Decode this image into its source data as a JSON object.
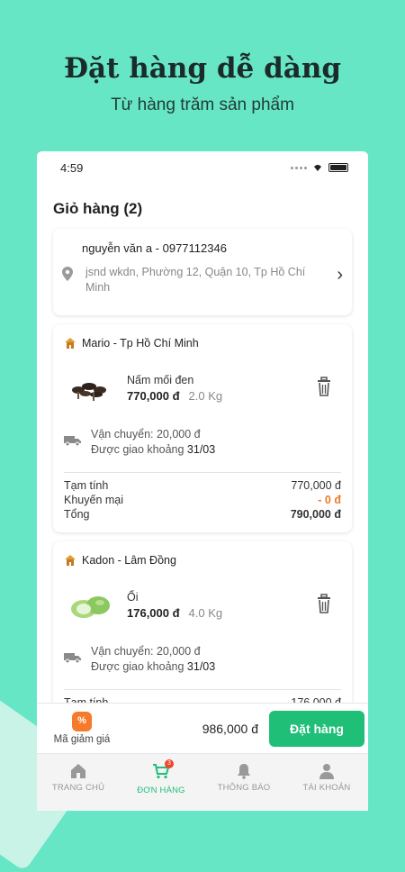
{
  "hero": {
    "title": "Đặt hàng dễ dàng",
    "subtitle": "Từ hàng trăm sản phẩm"
  },
  "status_bar": {
    "time": "4:59"
  },
  "cart": {
    "title": "Giỏ hàng (2)",
    "address": {
      "name_phone": "nguyễn văn a - 0977112346",
      "address": "jsnd wkdn, Phường 12, Quận 10, Tp Hồ Chí Minh"
    },
    "shops": [
      {
        "shop_name": "Mario - Tp Hồ Chí Minh",
        "product_name": "Nấm mối đen",
        "price": "770,000 đ",
        "qty": "2.0 Kg",
        "shipping_fee": "Vận chuyển: 20,000 đ",
        "delivery_label": "Được giao khoảng",
        "delivery_date": "31/03",
        "subtotal_label": "Tạm tính",
        "subtotal": "770,000 đ",
        "discount_label": "Khuyến mại",
        "discount": "- 0 đ",
        "total_label": "Tổng",
        "total": "790,000 đ"
      },
      {
        "shop_name": "Kadon - Lâm Đồng",
        "product_name": "Ổi",
        "price": "176,000 đ",
        "qty": "4.0 Kg",
        "shipping_fee": "Vận chuyển: 20,000 đ",
        "delivery_label": "Được giao khoảng",
        "delivery_date": "31/03",
        "subtotal_label": "Tạm tính",
        "subtotal": "176,000 đ"
      }
    ]
  },
  "checkout": {
    "voucher_label": "Mã giảm giá",
    "grand_total": "986,000 đ",
    "order_button": "Đặt hàng"
  },
  "tabs": [
    {
      "label": "TRANG CHỦ",
      "icon": "home-icon"
    },
    {
      "label": "ĐƠN HÀNG",
      "icon": "cart-icon",
      "badge": "3"
    },
    {
      "label": "THÔNG BÁO",
      "icon": "bell-icon"
    },
    {
      "label": "TÀI KHOẢN",
      "icon": "user-icon"
    }
  ],
  "colors": {
    "background": "#67e6c6",
    "primary": "#1fbf78",
    "discount": "#f07a2a",
    "voucher": "#f57a2a"
  }
}
